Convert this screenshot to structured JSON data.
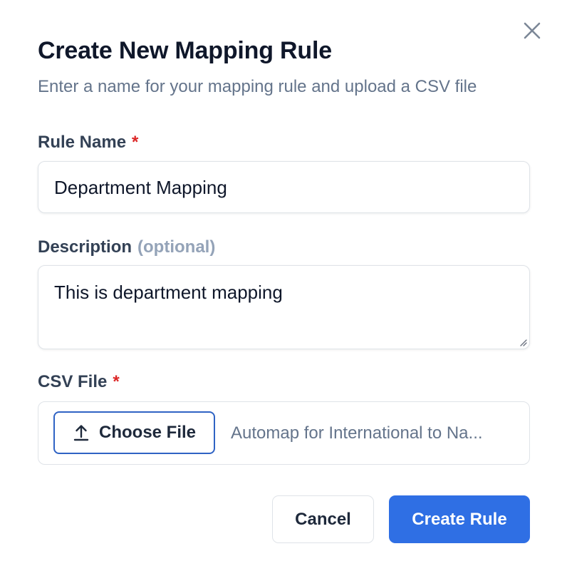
{
  "dialog": {
    "title": "Create New Mapping Rule",
    "subtitle": "Enter a name for your mapping rule and upload a CSV file",
    "close_icon": "close-icon"
  },
  "form": {
    "rule_name": {
      "label": "Rule Name",
      "required_marker": "*",
      "value": "Department Mapping"
    },
    "description": {
      "label": "Description",
      "optional_hint": "(optional)",
      "value": "This is department mapping"
    },
    "csv_file": {
      "label": "CSV File",
      "required_marker": "*",
      "choose_button_label": "Choose File",
      "choose_button_icon": "upload-icon",
      "selected_file": "Automap for International to Na..."
    }
  },
  "actions": {
    "cancel_label": "Cancel",
    "create_label": "Create Rule"
  },
  "colors": {
    "primary": "#2f6fe4",
    "outline_accent": "#2f63c4",
    "required": "#dc2626",
    "muted": "#64748b"
  }
}
